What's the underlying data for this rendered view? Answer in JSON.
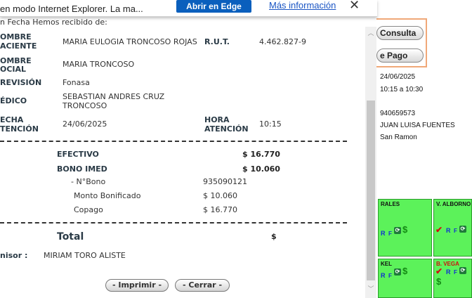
{
  "ie_bar": {
    "message": "en modo Internet Explorer. La ma...",
    "open_edge_label": "Abrir en Edge",
    "more_info_label": "Más información",
    "close_glyph": "✕"
  },
  "receipt": {
    "intro": "n Fecha Hemos recibido de:",
    "patient_label_1": "OMBRE",
    "patient_label_2": "ACIENTE",
    "patient_name": "MARIA EULOGIA TRONCOSO ROJAS",
    "rut_label": "R.U.T.",
    "rut_value": "4.462.827-9",
    "social_label_1": "OMBRE",
    "social_label_2": "OCIAL",
    "social_name": "MARIA TRONCOSO",
    "prevision_label": "REVISIÓN",
    "prevision_value": "Fonasa",
    "medico_label": "ÉDICO",
    "medico_line1": "SEBASTIAN ANDRES CRUZ",
    "medico_line2": "TRONCOSO",
    "fecha_label_1": "ECHA",
    "fecha_label_2": "TENCIÓN",
    "fecha_value": "24/06/2025",
    "hora_label_1": "HORA",
    "hora_label_2": "ATENCIÓN",
    "hora_value": "10:15"
  },
  "payments": {
    "efectivo_label": "EFECTIVO",
    "efectivo_value": "$ 16.770",
    "bono_label": "BONO IMED",
    "bono_value": "$ 10.060",
    "nbono_label": "- N°Bono",
    "nbono_value": "935090121",
    "monto_label": "Monto Bonificado",
    "monto_value": "$ 10.060",
    "copago_label": "Copago",
    "copago_value": "$ 16.770"
  },
  "total": {
    "label": "Total",
    "value": "$"
  },
  "emisor": {
    "label": "nisor :",
    "value": "MIRIAM TORO ALISTE"
  },
  "actions": {
    "print_label": "- Imprimir -",
    "close_label": "- Cerrar -"
  },
  "background_app": {
    "consulta_label": "Consulta",
    "pago_label": "e Pago",
    "date": "24/06/2025",
    "time_range": "10:15 a 10:30",
    "phone": "940659573",
    "name": "JUAN LUISA FUENTES",
    "commune": "San Ramon",
    "tiles": [
      {
        "name": "RALES"
      },
      {
        "name": "V. ALBORNO"
      },
      {
        "name": "KEL"
      },
      {
        "name": "B. VEGA"
      }
    ],
    "glyph_r": "R",
    "glyph_f": "F",
    "glyph_check": "✔",
    "glyph_sync": "⟳",
    "glyph_dollar": "$"
  },
  "colors": {
    "tile_green": "#5cf25a",
    "edge_blue": "#0a5fbd",
    "link_blue": "#1a55c4",
    "highlight_orange": "#f0a878"
  }
}
